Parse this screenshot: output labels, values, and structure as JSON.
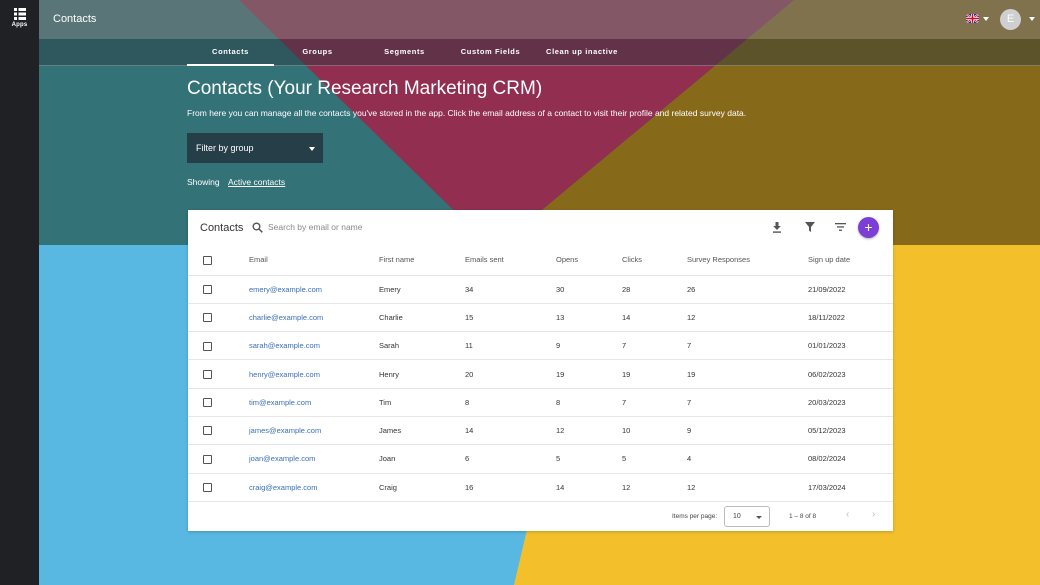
{
  "rail": {
    "apps_label": "Apps"
  },
  "header": {
    "title": "Contacts",
    "avatar_initial": "E"
  },
  "tabs": [
    {
      "label": "Contacts"
    },
    {
      "label": "Groups"
    },
    {
      "label": "Segments"
    },
    {
      "label": "Custom Fields"
    },
    {
      "label": "Clean up inactive"
    }
  ],
  "hero": {
    "title": "Contacts (Your Research Marketing CRM)",
    "subtitle": "From here you can manage all the contacts you've stored in the app. Click the email address of a contact to visit their profile and related survey data.",
    "filter_label": "Filter by group",
    "showing_label": "Showing",
    "showing_link": "Active contacts"
  },
  "card": {
    "title": "Contacts",
    "search_placeholder": "Search by email or name"
  },
  "table": {
    "columns": [
      "Email",
      "First name",
      "Emails sent",
      "Opens",
      "Clicks",
      "Survey Responses",
      "Sign up date"
    ],
    "rows": [
      [
        "emery@example.com",
        "Emery",
        "34",
        "30",
        "28",
        "26",
        "21/09/2022"
      ],
      [
        "charlie@example.com",
        "Charlie",
        "15",
        "13",
        "14",
        "12",
        "18/11/2022"
      ],
      [
        "sarah@example.com",
        "Sarah",
        "11",
        "9",
        "7",
        "7",
        "01/01/2023"
      ],
      [
        "henry@example.com",
        "Henry",
        "20",
        "19",
        "19",
        "19",
        "06/02/2023"
      ],
      [
        "tim@example.com",
        "Tim",
        "8",
        "8",
        "7",
        "7",
        "20/03/2023"
      ],
      [
        "james@example.com",
        "James",
        "14",
        "12",
        "10",
        "9",
        "05/12/2023"
      ],
      [
        "joan@example.com",
        "Joan",
        "6",
        "5",
        "5",
        "4",
        "08/02/2024"
      ],
      [
        "craig@example.com",
        "Craig",
        "16",
        "14",
        "12",
        "12",
        "17/03/2024"
      ]
    ]
  },
  "pager": {
    "items_per_page_label": "Items per page:",
    "items_per_page_value": "10",
    "range": "1 – 8 of 8"
  },
  "colors": {
    "accent": "#7b3fd6",
    "link": "#3b6fb6",
    "rail": "#1f2124"
  }
}
